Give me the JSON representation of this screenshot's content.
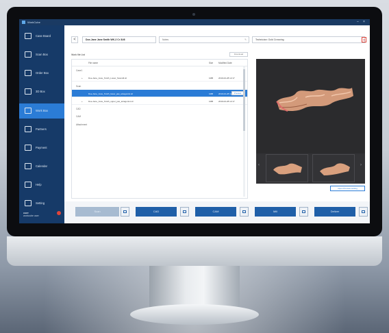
{
  "app": {
    "title": "WorkCube"
  },
  "sidebar": {
    "items": [
      {
        "label": "Case Board",
        "icon": "grid-icon"
      },
      {
        "label": "Scan Box",
        "icon": "scanner-icon"
      },
      {
        "label": "Order Box",
        "icon": "order-icon"
      },
      {
        "label": "3D Box",
        "icon": "monitor-icon"
      },
      {
        "label": "Work Box",
        "icon": "workbox-icon",
        "active": true
      },
      {
        "label": "Partners",
        "icon": "partners-icon"
      },
      {
        "label": "Payment",
        "icon": "payment-icon"
      },
      {
        "label": "Calendar",
        "icon": "calendar-icon"
      },
      {
        "label": "Help",
        "icon": "help-icon"
      },
      {
        "label": "Setting",
        "icon": "settings-icon"
      }
    ],
    "user": {
      "name": "user",
      "sub": "workcube user"
    }
  },
  "topbar": {
    "back": "<",
    "case": "Doe-Jane  Jane Smith  WK-2 Cr 3U6",
    "notes_placeholder": "Notes",
    "technician": "Technician: Gold Crowning"
  },
  "file_list": {
    "title": "Work file List",
    "download_label": "Download",
    "columns": {
      "name": "File name",
      "size": "Size",
      "modified": "Modified Date"
    },
    "groups": [
      {
        "label": "Case1",
        "rows": [
          {
            "name": "Doe-Jane_Jane_Smith_Lower_ScanAll.stl",
            "size": "1MB",
            "date": "2019-02-28 12:17",
            "selected": false
          }
        ]
      },
      {
        "label": "Scan",
        "rows": [
          {
            "name": "Doe-Jane_Jane_Smith_lower_jaw_antagonist.stl",
            "size": "1MB",
            "date": "2019-02-28 12:17",
            "selected": true,
            "action": "Preview"
          },
          {
            "name": "Doe-Jane_Jane_Smith_upper_jaw_antagonist.stl",
            "size": "1MB",
            "date": "2019-02-28 12:17",
            "selected": false
          }
        ]
      },
      {
        "label": "CAD",
        "rows": []
      },
      {
        "label": "CAM",
        "rows": []
      },
      {
        "label": "Attachment",
        "rows": []
      }
    ]
  },
  "viewer": {
    "open_button": "Open Preview setting"
  },
  "bottom": {
    "buttons": [
      {
        "label": "Scan",
        "disabled": true
      },
      {
        "label": "CAD",
        "disabled": false
      },
      {
        "label": "CAM",
        "disabled": false
      },
      {
        "label": "Mill",
        "disabled": false
      },
      {
        "label": "Deliver",
        "disabled": false
      }
    ]
  }
}
